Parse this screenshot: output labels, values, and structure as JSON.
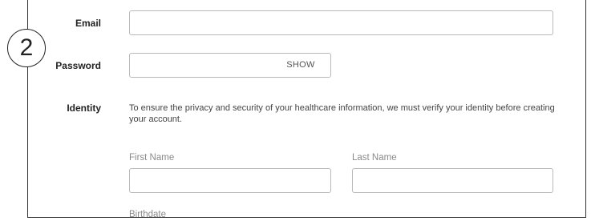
{
  "step": {
    "number": "2"
  },
  "form": {
    "email": {
      "label": "Email",
      "value": "",
      "placeholder": ""
    },
    "password": {
      "label": "Password",
      "value": "",
      "placeholder": "",
      "toggle_label": "SHOW"
    },
    "identity": {
      "label": "Identity",
      "help_text": "To ensure the privacy and security of your healthcare information, we must verify your identity before creating your account.",
      "first_name": {
        "label": "First Name",
        "value": ""
      },
      "last_name": {
        "label": "Last Name",
        "value": ""
      },
      "birthdate": {
        "label": "Birthdate"
      }
    }
  },
  "colors": {
    "border": "#b9b9b9",
    "frame": "#333333",
    "muted_label": "#8a8a8a"
  }
}
